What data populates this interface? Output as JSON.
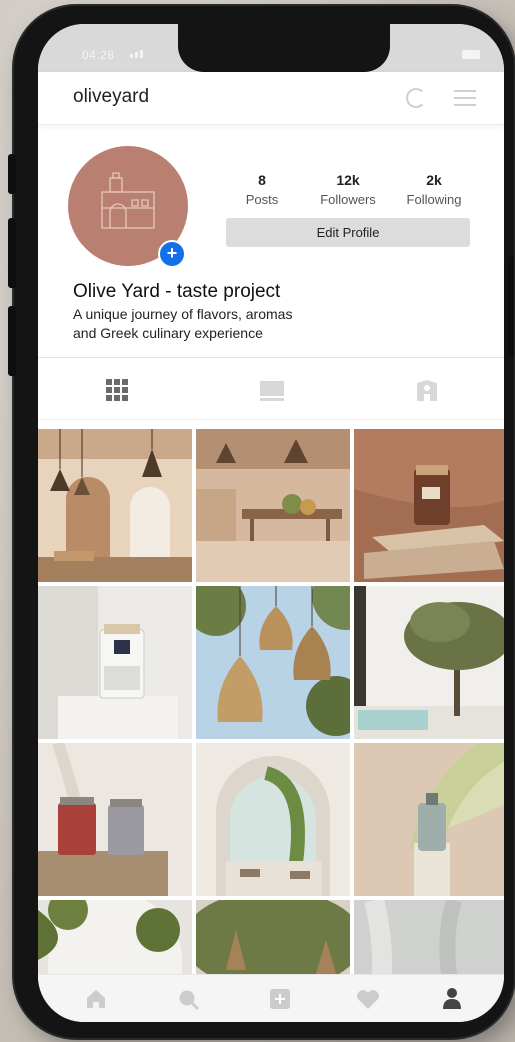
{
  "status_bar": {
    "time": "04:28"
  },
  "header": {
    "username": "oliveyard",
    "refresh_icon": "refresh-icon",
    "menu_icon": "hamburger-menu-icon"
  },
  "profile": {
    "avatar_color": "#b98072",
    "stats": [
      {
        "value": "8",
        "label": "Posts"
      },
      {
        "value": "12k",
        "label": "Followers"
      },
      {
        "value": "2k",
        "label": "Following"
      }
    ],
    "edit_button": "Edit Profile",
    "name": "Olive Yard - taste project",
    "bio_lines": [
      "A unique journey of flavors, aromas",
      "and Greek culinary experience"
    ]
  },
  "tabs": [
    {
      "icon": "grid-icon",
      "active": true
    },
    {
      "icon": "list-view-icon",
      "active": false
    },
    {
      "icon": "tagged-icon",
      "active": false
    }
  ],
  "grid_posts": [
    {
      "subject": "cafe-interior-arches-lamps"
    },
    {
      "subject": "dining-room-wooden-tables"
    },
    {
      "subject": "amber-jar-on-stone"
    },
    {
      "subject": "white-jar-on-pedestal"
    },
    {
      "subject": "rattan-pendant-lamps"
    },
    {
      "subject": "olive-tree-courtyard"
    },
    {
      "subject": "red-and-silver-jars"
    },
    {
      "subject": "white-arch-stairs"
    },
    {
      "subject": "glass-bottle-palm-leaf"
    },
    {
      "subject": "olive-branch-arch"
    },
    {
      "subject": "olive-tree-lamps"
    },
    {
      "subject": "white-linen"
    }
  ],
  "bottom_nav": [
    {
      "icon": "home-icon"
    },
    {
      "icon": "search-icon"
    },
    {
      "icon": "add-post-icon"
    },
    {
      "icon": "heart-icon"
    },
    {
      "icon": "profile-icon",
      "active": true
    }
  ],
  "colors": {
    "accent_blue": "#1470e8",
    "button_gray": "#dcdcdc",
    "avatar": "#b98072"
  }
}
